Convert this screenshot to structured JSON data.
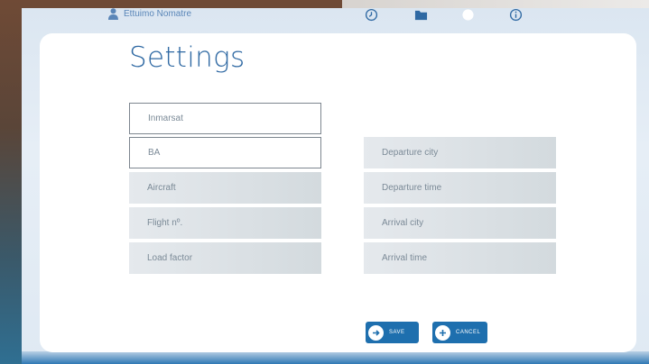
{
  "user": {
    "name": "Ettuimo Nomatre"
  },
  "nav_icons": [
    "clock-icon",
    "folder-icon",
    "globe-icon",
    "info-icon"
  ],
  "page": {
    "title": "Settings"
  },
  "fields_left": [
    {
      "key": "operator",
      "text": "Inmarsat",
      "state": "input"
    },
    {
      "key": "airline",
      "text": "BA",
      "state": "input"
    },
    {
      "key": "aircraft",
      "text": "Aircraft",
      "state": "placeholder"
    },
    {
      "key": "flight-no",
      "text": "Flight nº.",
      "state": "placeholder"
    },
    {
      "key": "load-factor",
      "text": "Load factor",
      "state": "placeholder"
    }
  ],
  "fields_right": [
    {
      "key": "departure-city",
      "text": "Departure city"
    },
    {
      "key": "departure-time",
      "text": "Departure time"
    },
    {
      "key": "arrival-city",
      "text": "Arrival city"
    },
    {
      "key": "arrival-time",
      "text": "Arrival time"
    }
  ],
  "buttons": {
    "save": "SAVE",
    "cancel": "CANCEL"
  },
  "colors": {
    "accent": "#1e6fae",
    "title": "#2f69a3",
    "field_fill": "#dbe1e5"
  }
}
